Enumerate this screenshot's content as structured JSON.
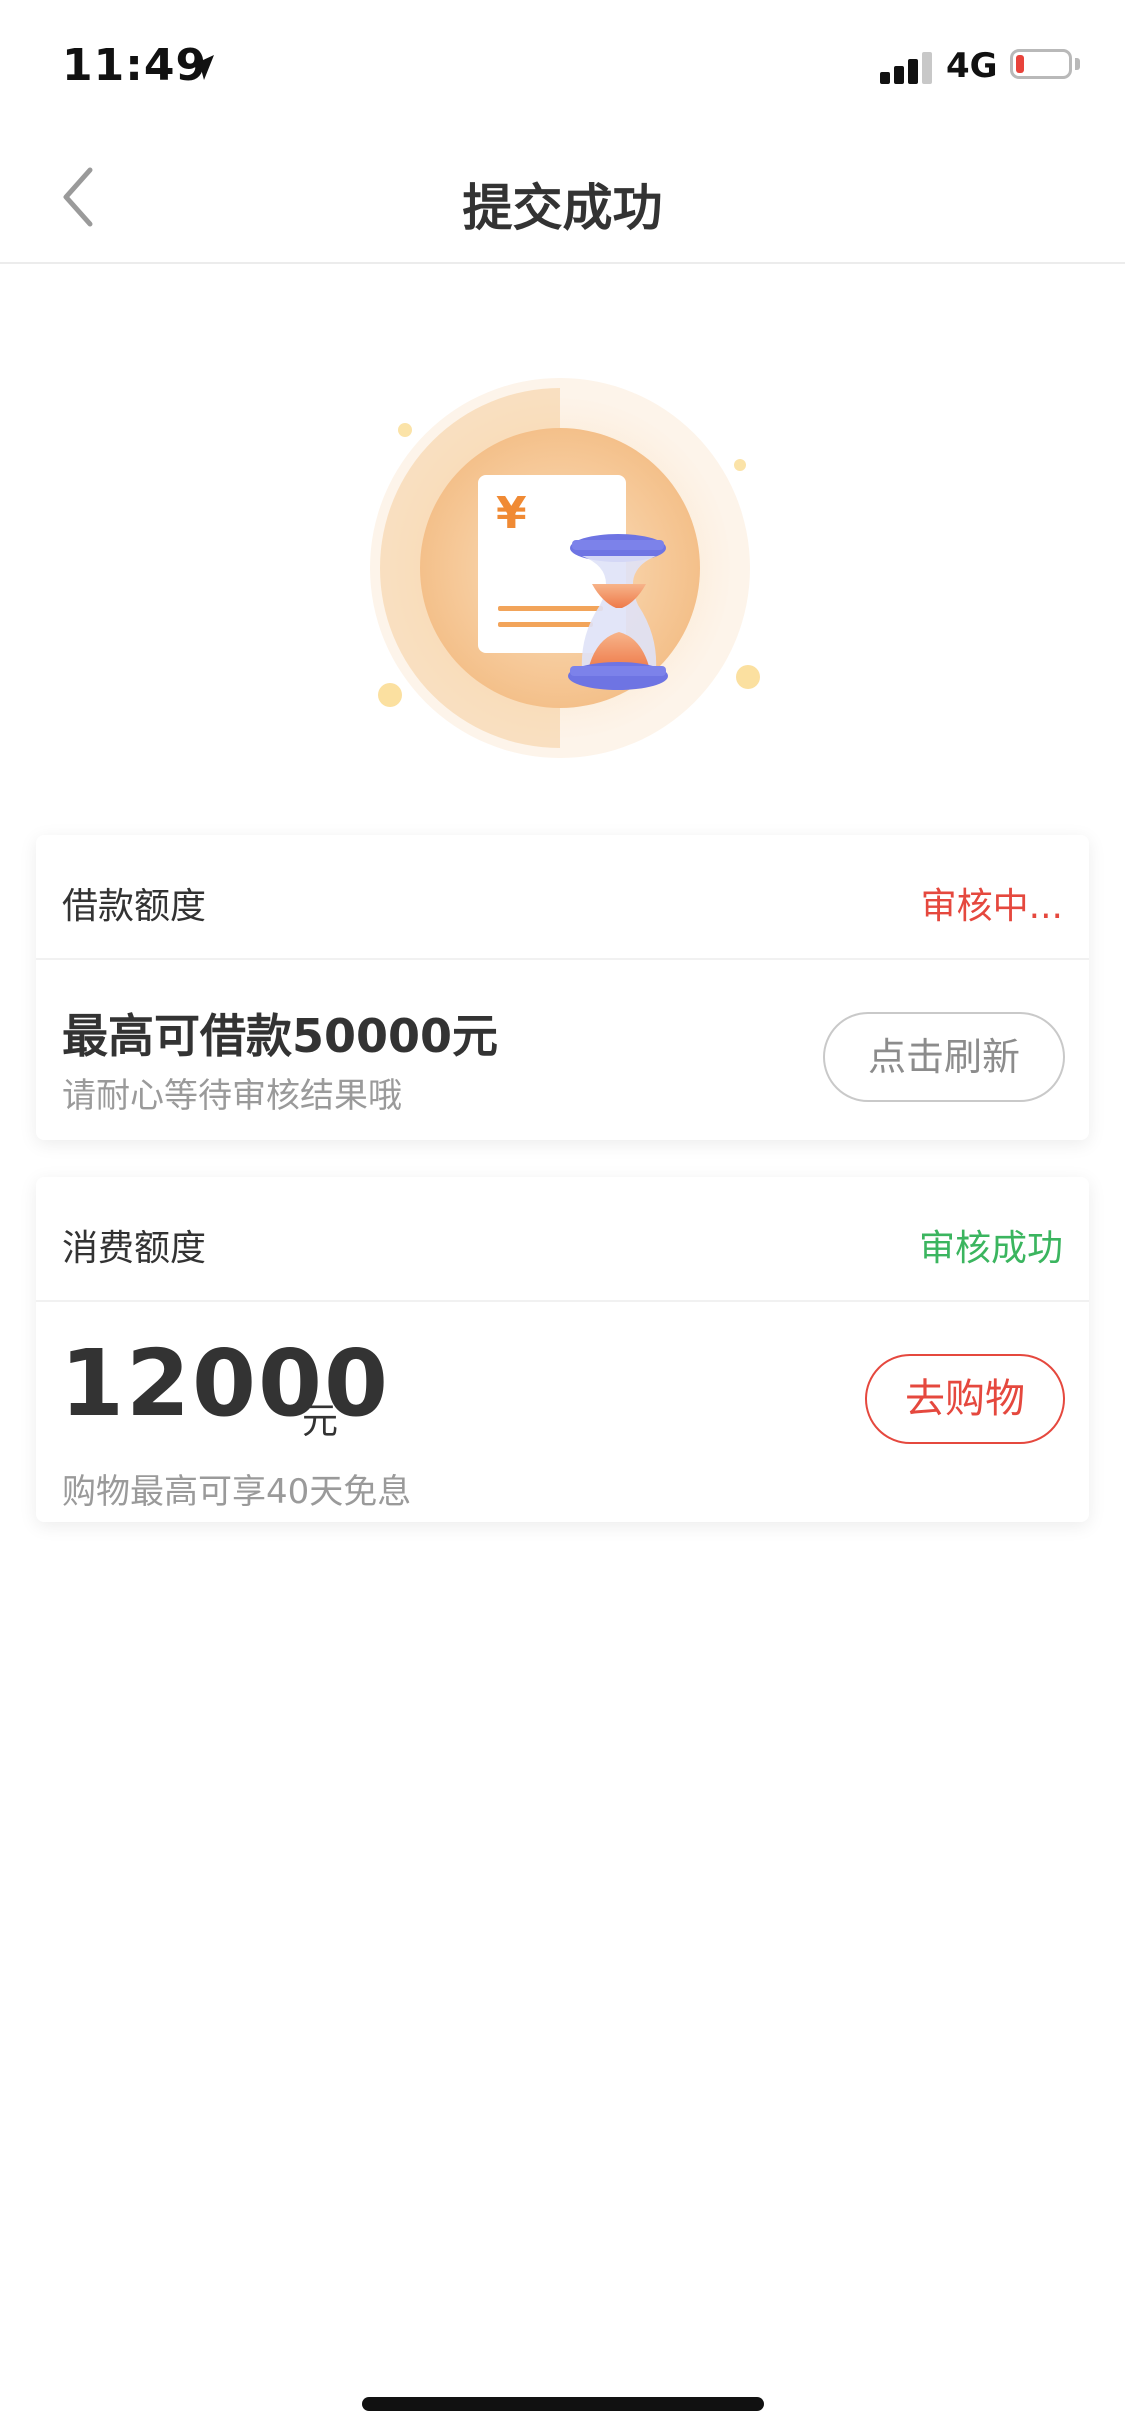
{
  "status_bar": {
    "time": "11:49",
    "network": "4G",
    "battery_level": 0.15,
    "signal_bars_active": 3
  },
  "nav": {
    "title": "提交成功"
  },
  "illustration": {
    "currency_symbol": "¥"
  },
  "loan_card": {
    "label": "借款额度",
    "status": "审核中...",
    "status_color": "#e5483e",
    "title": "最高可借款50000元",
    "subtitle": "请耐心等待审核结果哦",
    "refresh_label": "点击刷新"
  },
  "consume_card": {
    "label": "消费额度",
    "status": "审核成功",
    "status_color": "#3bb55f",
    "amount": "12000",
    "unit": "元",
    "subtitle": "购物最高可享40天免息",
    "shop_label": "去购物"
  },
  "colors": {
    "accent": "#e5483e",
    "success": "#3bb55f",
    "illustration_orange": "#f2a45a",
    "hourglass_blue": "#6e74e3"
  }
}
